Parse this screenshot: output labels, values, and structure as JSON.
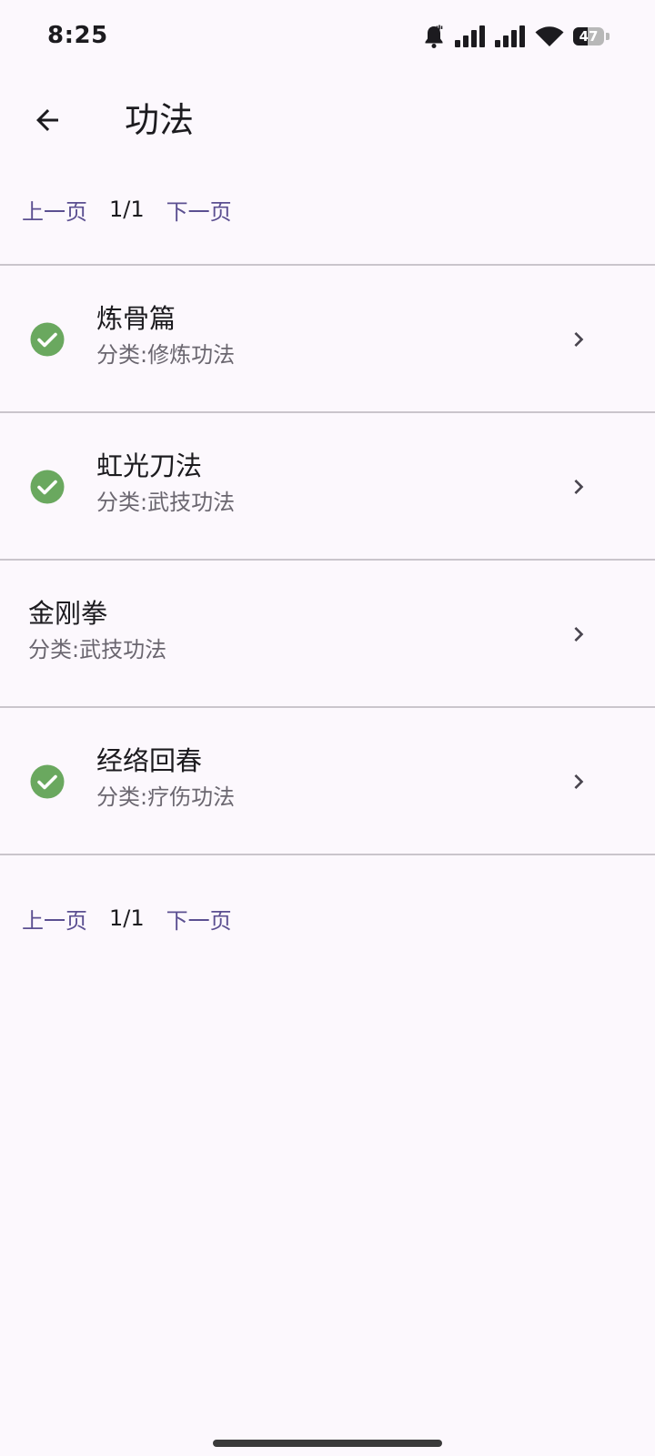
{
  "status_bar": {
    "time": "8:25",
    "battery_level": "47",
    "icons": [
      "bell-ring-icon",
      "signal-icon",
      "signal-icon",
      "wifi-icon",
      "battery-icon"
    ]
  },
  "app_bar": {
    "back_icon": "arrow-left-icon",
    "title": "功法"
  },
  "pager": {
    "prev_label": "上一页",
    "page_indicator": "1/1",
    "next_label": "下一页"
  },
  "items": [
    {
      "title": "炼骨篇",
      "subtitle": "分类:修炼功法",
      "completed": true
    },
    {
      "title": "虹光刀法",
      "subtitle": "分类:武技功法",
      "completed": true
    },
    {
      "title": "金刚拳",
      "subtitle": "分类:武技功法",
      "completed": false
    },
    {
      "title": "经络回春",
      "subtitle": "分类:疗伤功法",
      "completed": true
    }
  ],
  "colors": {
    "background": "#fcf8fd",
    "accent_link": "#5b4f91",
    "check_green": "#6aa85f",
    "divider": "#cac5cc"
  }
}
